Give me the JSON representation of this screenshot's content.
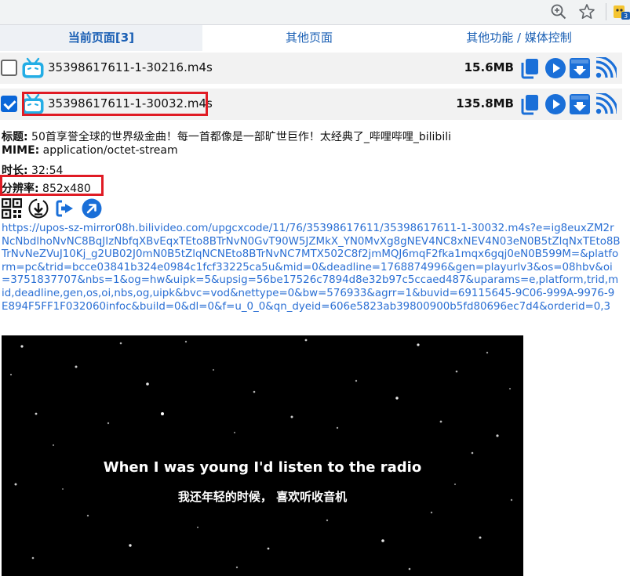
{
  "tabs": [
    {
      "label": "当前页面[3]",
      "active": true
    },
    {
      "label": "其他页面",
      "active": false
    },
    {
      "label": "其他功能 / 媒体控制",
      "active": false
    }
  ],
  "extension_badge": "3",
  "files": [
    {
      "name": "35398617611-1-30216.m4s",
      "size": "15.6MB",
      "checked": false
    },
    {
      "name": "35398617611-1-30032.m4s",
      "size": "135.8MB",
      "checked": true
    }
  ],
  "details": {
    "title_label": "标题:",
    "title_value": " 50首享誉全球的世界级金曲！每一首都像是一部旷世巨作！太经典了_哔哩哔哩_bilibili",
    "mime_label": "MIME:",
    "mime_value": " application/octet-stream",
    "duration_label": "时长:",
    "duration_value": " 32:54",
    "resolution_label": "分辨率:",
    "resolution_value": " 852x480"
  },
  "url": "https://upos-sz-mirror08h.bilivideo.com/upgcxcode/11/76/35398617611/35398617611-1-30032.m4s?e=ig8euxZM2rNcNbdlhoNvNC8BqJIzNbfqXBvEqxTEto8BTrNvN0GvT90W5JZMkX_YN0MvXg8gNEV4NC8xNEV4N03eN0B5tZlqNxTEto8BTrNvNeZVuJ10Kj_g2UB02J0mN0B5tZlqNCNEto8BTrNvNC7MTX502C8f2jmMQJ6mqF2fka1mqx6gqj0eN0B599M=&platform=pc&trid=bcce03841b324e0984c1fcf33225ca5u&mid=0&deadline=1768874996&gen=playurlv3&os=08hbv&oi=3751837707&nbs=1&og=hw&uipk=5&upsig=56be17526c7894d8e32b97c5ccaed487&uparams=e,platform,trid,mid,deadline,gen,os,oi,nbs,og,uipk&bvc=vod&nettype=0&bw=576933&agrr=1&buvid=69115645-9C06-999A-9976-9E894F5FF1F032060infoc&build=0&dl=0&f=u_0_0&qn_dyeid=606e5823ab39800900b5fd80696ec7d4&orderid=0,3",
  "video": {
    "subtitle_en": "When I was young I'd listen to the radio",
    "subtitle_zh": "我还年轻的时候， 喜欢听收音机"
  },
  "colors": {
    "accent": "#1a6fd8",
    "highlight": "#e01b24",
    "link": "#2a6fd4",
    "bilibili": "#23ade5"
  },
  "icons": {
    "copy": "copy-icon",
    "play": "play-icon",
    "download": "download-icon",
    "send": "rss-send-icon",
    "qr": "qrcode-icon",
    "download_circle": "download-circle-icon",
    "invoke": "invoke-app-icon",
    "open": "open-new-icon"
  }
}
